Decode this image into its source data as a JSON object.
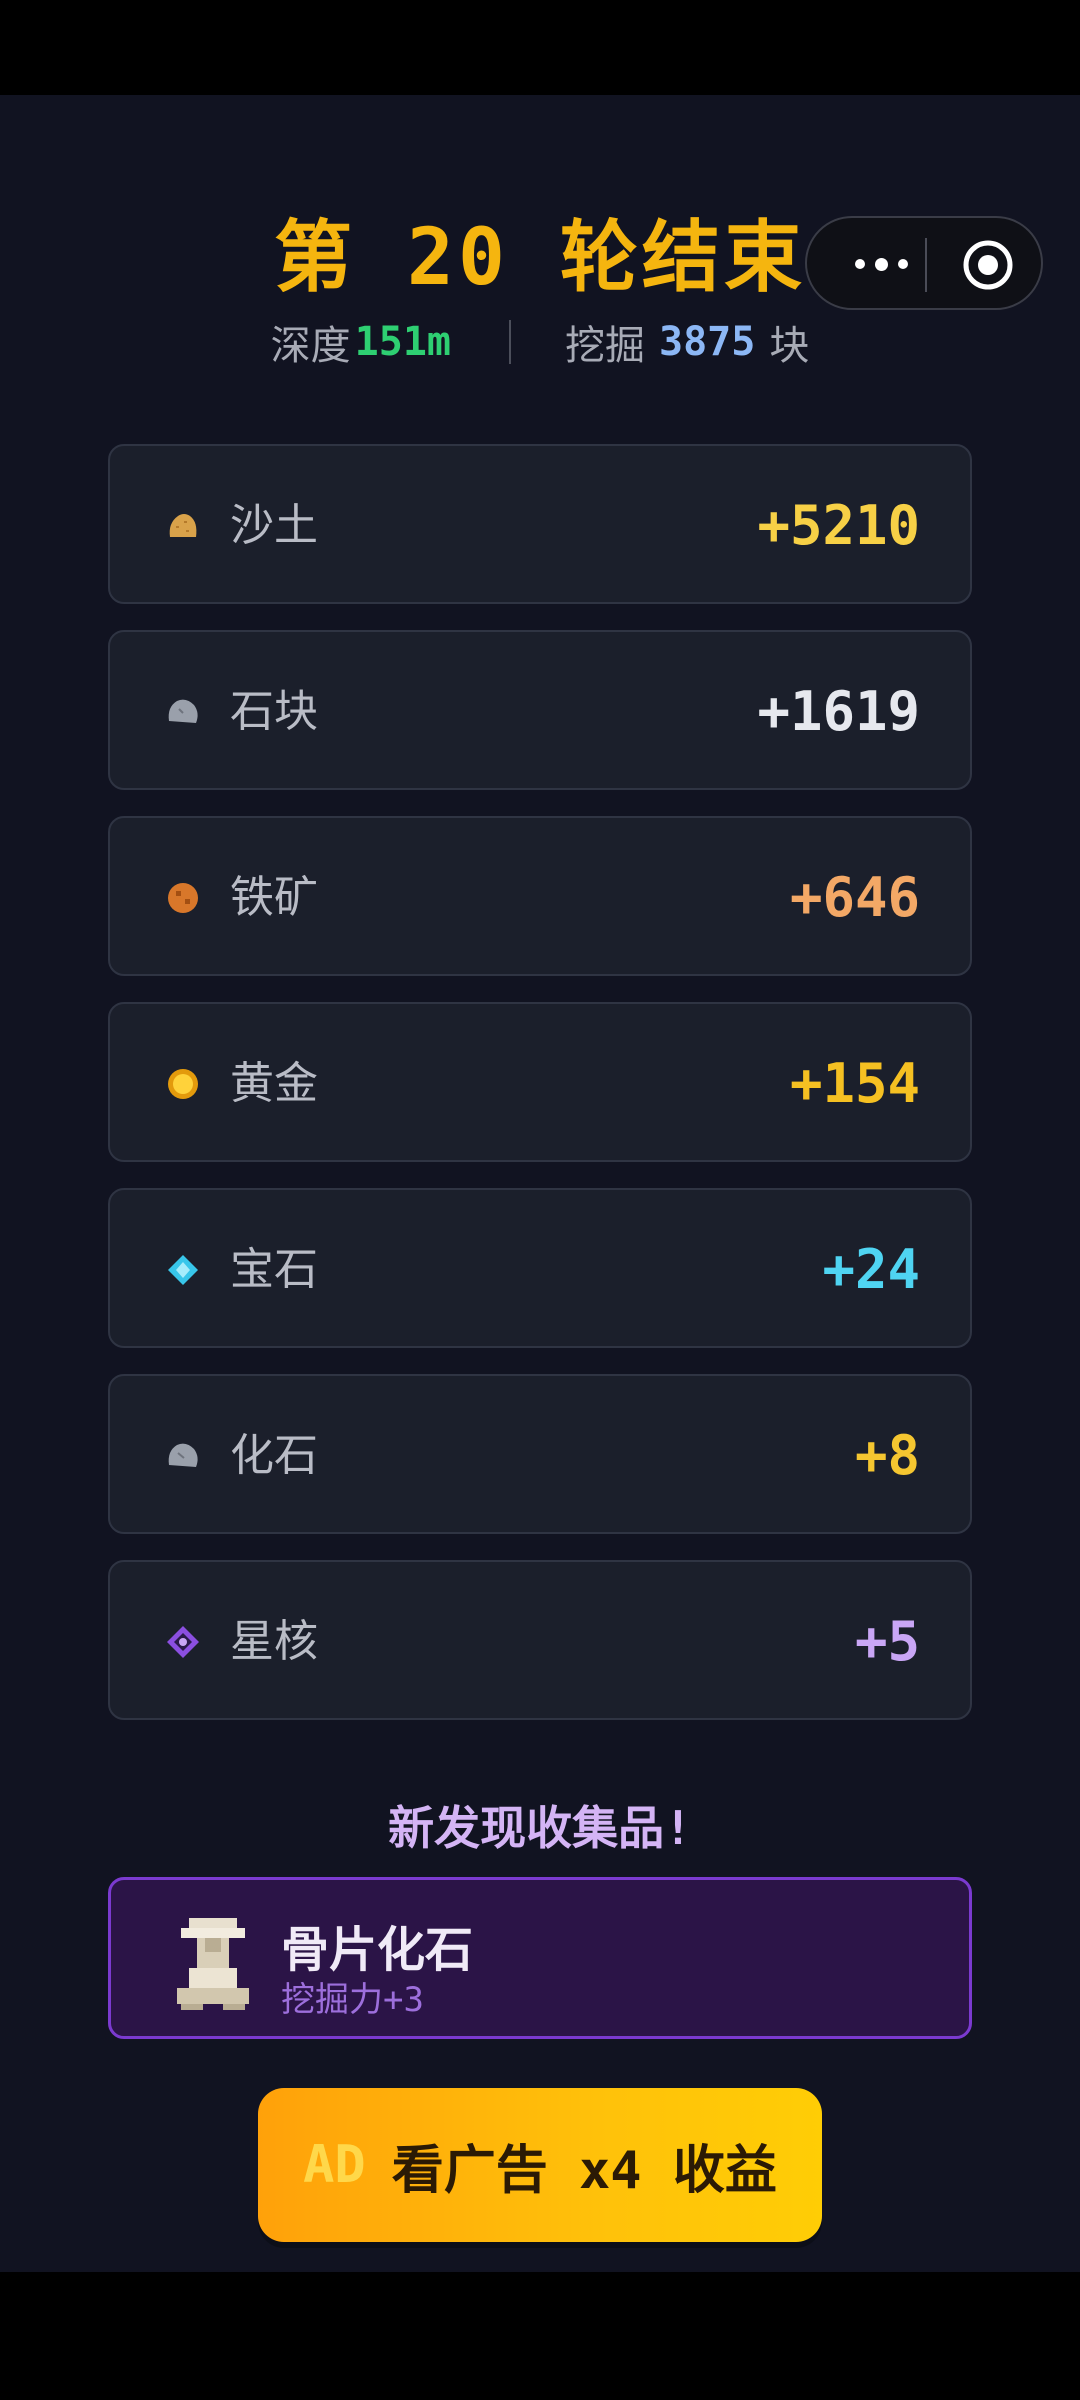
{
  "header": {
    "title": "第 20 轮结束",
    "depth_label": "深度",
    "depth_value": "151m",
    "dig_label": "挖掘",
    "dig_value": "3875",
    "dig_unit": "块"
  },
  "capsule": {
    "more_icon": "more-dots-icon",
    "close_icon": "target-circle-icon"
  },
  "rewards": [
    {
      "name": "沙土",
      "value": "+5210",
      "color": "#f7d046",
      "icon": "sand-icon",
      "icon_color": "#d9a24a"
    },
    {
      "name": "石块",
      "value": "+1619",
      "color": "#e6e8ee",
      "icon": "stone-icon",
      "icon_color": "#9aa0ab"
    },
    {
      "name": "铁矿",
      "value": "+646",
      "color": "#f3a866",
      "icon": "iron-ore-icon",
      "icon_color": "#d8772a"
    },
    {
      "name": "黄金",
      "value": "+154",
      "color": "#f5c022",
      "icon": "gold-icon",
      "icon_color": "#f2b11a"
    },
    {
      "name": "宝石",
      "value": "+24",
      "color": "#4fd4f2",
      "icon": "gem-icon",
      "icon_color": "#38c6ea"
    },
    {
      "name": "化石",
      "value": "+8",
      "color": "#f5c630",
      "icon": "fossil-icon",
      "icon_color": "#9aa0ab"
    },
    {
      "name": "星核",
      "value": "+5",
      "color": "#c9a6f5",
      "icon": "star-core-icon",
      "icon_color": "#8b4fe0"
    }
  ],
  "new_collectible": {
    "heading": "新发现收集品!",
    "name": "骨片化石",
    "desc": "挖掘力+3",
    "icon": "bone-fossil-icon"
  },
  "ad_button": {
    "tag": "AD",
    "label": "看广告 x4 收益"
  }
}
